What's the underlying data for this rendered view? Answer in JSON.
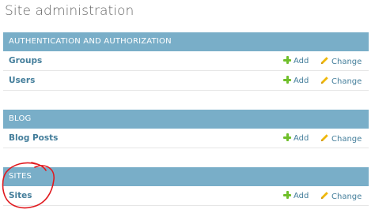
{
  "page": {
    "title": "Site administration"
  },
  "modules": [
    {
      "caption": "AUTHENTICATION AND AUTHORIZATION",
      "models": [
        {
          "name": "Groups",
          "add_label": "Add",
          "change_label": "Change"
        },
        {
          "name": "Users",
          "add_label": "Add",
          "change_label": "Change"
        }
      ]
    },
    {
      "caption": "BLOG",
      "models": [
        {
          "name": "Blog Posts",
          "add_label": "Add",
          "change_label": "Change"
        }
      ]
    },
    {
      "caption": "SITES",
      "models": [
        {
          "name": "Sites",
          "add_label": "Add",
          "change_label": "Change"
        }
      ]
    }
  ],
  "icons": {
    "add": "plus-icon",
    "change": "pencil-icon"
  },
  "colors": {
    "module_header_bg": "#79aec8",
    "link": "#447e9b",
    "add_icon": "#70bf2b",
    "change_icon": "#efb80b",
    "annotation": "#e0191e"
  }
}
